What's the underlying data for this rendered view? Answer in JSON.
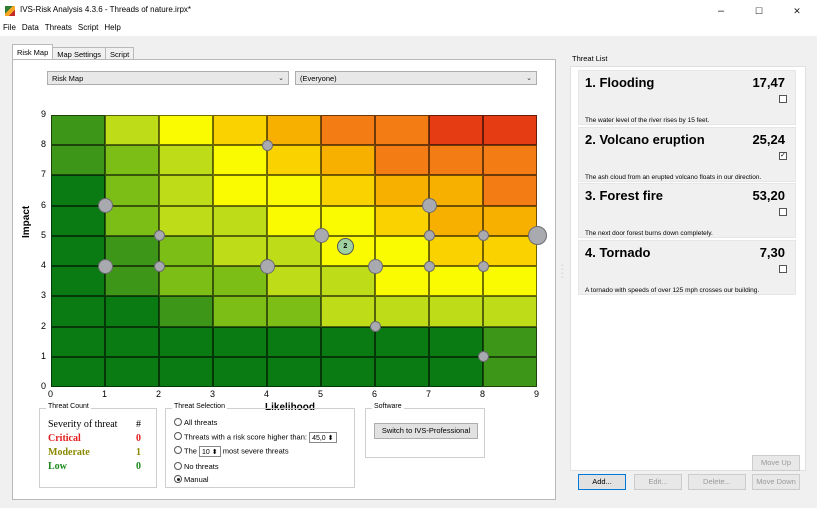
{
  "window": {
    "title": "IVS-Risk Analysis 4.3.6 - Threads of nature.irpx*",
    "min_label": "–",
    "max_label": "☐",
    "close_label": "✕"
  },
  "menu": [
    "File",
    "Data",
    "Threats",
    "Script",
    "Help"
  ],
  "tabs": [
    "Risk Map",
    "Map Settings",
    "Script"
  ],
  "map_select": {
    "value": "Risk Map"
  },
  "group_select": {
    "value": "(Everyone)"
  },
  "risk_map": {
    "y_label": "Impact",
    "x_label": "Likelihood",
    "x_ticks": [
      "0",
      "1",
      "2",
      "3",
      "4",
      "5",
      "6",
      "7",
      "8",
      "9"
    ],
    "y_ticks": [
      "0",
      "1",
      "2",
      "3",
      "4",
      "5",
      "6",
      "7",
      "8",
      "9"
    ],
    "x_range": [
      0,
      9
    ],
    "y_range": [
      0,
      9
    ],
    "colors": {
      "c0": "#0a7a12",
      "c1": "#3d9618",
      "c2": "#7cbd16",
      "c3": "#bedc18",
      "c4": "#fafa00",
      "c5": "#fad200",
      "c6": "#f8b000",
      "c7": "#f37d14",
      "c8": "#e63c14"
    },
    "cell_levels": [
      [
        0,
        0,
        0,
        0,
        0,
        0,
        0,
        0,
        1
      ],
      [
        0,
        0,
        0,
        0,
        0,
        0,
        0,
        0,
        1
      ],
      [
        0,
        0,
        1,
        2,
        2,
        3,
        3,
        3,
        3
      ],
      [
        0,
        1,
        2,
        2,
        3,
        3,
        4,
        4,
        4
      ],
      [
        0,
        1,
        2,
        3,
        3,
        4,
        4,
        5,
        5
      ],
      [
        0,
        2,
        3,
        3,
        4,
        4,
        5,
        6,
        6
      ],
      [
        0,
        2,
        3,
        4,
        4,
        5,
        6,
        6,
        7
      ],
      [
        1,
        2,
        3,
        4,
        5,
        6,
        7,
        7,
        7
      ],
      [
        1,
        3,
        4,
        5,
        6,
        7,
        7,
        8,
        8
      ]
    ],
    "markers": [
      {
        "x": 1,
        "y": 6,
        "size": "m"
      },
      {
        "x": 1,
        "y": 4,
        "size": "m"
      },
      {
        "x": 2,
        "y": 5,
        "size": "s"
      },
      {
        "x": 2,
        "y": 4,
        "size": "s"
      },
      {
        "x": 4,
        "y": 8,
        "size": "s"
      },
      {
        "x": 4,
        "y": 4,
        "size": "m"
      },
      {
        "x": 5,
        "y": 5,
        "size": "m"
      },
      {
        "x": 6,
        "y": 4,
        "size": "m"
      },
      {
        "x": 6,
        "y": 2,
        "size": "s"
      },
      {
        "x": 7,
        "y": 6,
        "size": "m"
      },
      {
        "x": 7,
        "y": 5,
        "size": "s"
      },
      {
        "x": 7,
        "y": 4,
        "size": "s"
      },
      {
        "x": 8,
        "y": 5,
        "size": "s"
      },
      {
        "x": 8,
        "y": 4,
        "size": "s"
      },
      {
        "x": 8,
        "y": 1,
        "size": "s"
      },
      {
        "x": 9,
        "y": 5,
        "size": "l"
      }
    ],
    "selected_marker": {
      "x": 5.45,
      "y": 4.65,
      "label": "2"
    }
  },
  "threat_count": {
    "title": "Threat Count",
    "header_label": "Severity of threat",
    "header_hash": "#",
    "rows": [
      {
        "label": "Critical",
        "value": "0",
        "color": "#e31c1c"
      },
      {
        "label": "Moderate",
        "value": "1",
        "color": "#8a8a00"
      },
      {
        "label": "Low",
        "value": "0",
        "color": "#1a8a1a"
      }
    ]
  },
  "threat_selection": {
    "title": "Threat Selection",
    "opt_all": "All threats",
    "opt_score": "Threats with a risk score higher than:",
    "score_value": "45,0",
    "opt_the": "The",
    "the_value": "10",
    "opt_the_suffix": "most severe threats",
    "opt_none": "No threats",
    "opt_manual": "Manual"
  },
  "software": {
    "title": "Software",
    "button": "Switch to IVS-Professional"
  },
  "threat_list": {
    "title": "Threat List",
    "items": [
      {
        "name": "1. Flooding",
        "score": "17,47",
        "desc": "The water level of the river rises by 15 feet.",
        "checked": false
      },
      {
        "name": "2. Volcano eruption",
        "score": "25,24",
        "desc": "The ash cloud from an erupted volcano floats in our direction.",
        "checked": true
      },
      {
        "name": "3. Forest fire",
        "score": "53,20",
        "desc": "The next door forest burns down completely.",
        "checked": false
      },
      {
        "name": "4. Tornado",
        "score": "7,30",
        "desc": "A tornado with speeds of over 125 mph crosses our building.",
        "checked": false
      }
    ]
  },
  "buttons": {
    "add": "Add...",
    "edit": "Edit...",
    "delete": "Delete...",
    "move_up": "Move Up",
    "move_down": "Move Down"
  }
}
